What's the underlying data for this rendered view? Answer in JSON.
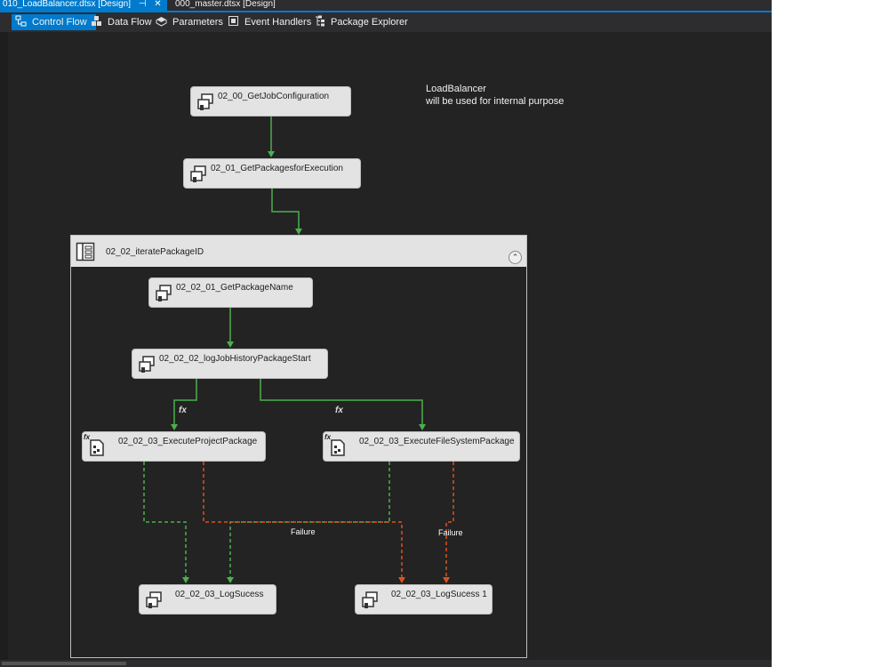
{
  "document_tabs": [
    {
      "label": "010_LoadBalancer.dtsx [Design]",
      "active": true
    },
    {
      "label": "000_master.dtsx [Design]",
      "active": false
    }
  ],
  "toolbar": {
    "tabs": [
      {
        "label": "Control Flow",
        "icon": "control-flow-icon",
        "active": true
      },
      {
        "label": "Data Flow",
        "icon": "data-flow-icon",
        "active": false
      },
      {
        "label": "Parameters",
        "icon": "parameters-icon",
        "active": false
      },
      {
        "label": "Event Handlers",
        "icon": "event-handlers-icon",
        "active": false
      },
      {
        "label": "Package Explorer",
        "icon": "package-explorer-icon",
        "active": false
      }
    ]
  },
  "annotation": {
    "line1": "LoadBalancer",
    "line2": "will be used for internal purpose"
  },
  "tasks": {
    "get_job_config": "02_00_GetJobConfiguration",
    "get_packages": "02_01_GetPackagesforExecution",
    "get_package_name": "02_02_01_GetPackageName",
    "log_history_start": "02_02_02_logJobHistoryPackageStart",
    "exec_project": "02_02_03_ExecuteProjectPackage",
    "exec_filesystem": "02_02_03_ExecuteFileSystemPackage",
    "log_success": "02_02_03_LogSucess",
    "log_success_1": "02_02_03_LogSucess 1"
  },
  "container": {
    "label": "02_02_iteratePackageID"
  },
  "connectors": {
    "failure_label_1": "Failure",
    "failure_label_2": "Failure",
    "expression_symbol": "fx"
  },
  "colors": {
    "success": "#4cb04c",
    "failure": "#d9531e",
    "accent": "#007acc"
  }
}
